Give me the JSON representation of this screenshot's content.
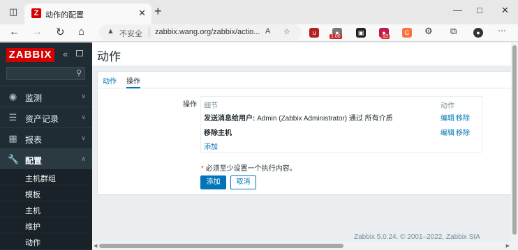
{
  "browser": {
    "tab_title": "动作的配置",
    "favicon_letter": "Z",
    "insecure_label": "不安全",
    "url": "zabbix.wang.org/zabbix/actio...",
    "ext_badge_1": "1.00",
    "ext_badge_2": "13",
    "icons": [
      "sidebar-toggle-icon",
      "close-icon",
      "plus-icon",
      "minimize-icon",
      "maximize-icon",
      "back-icon",
      "forward-icon",
      "reload-icon",
      "home-icon",
      "warning-icon",
      "read-aloud-icon",
      "favorite-icon",
      "ublock-icon",
      "extension-icon",
      "collections-icon",
      "profile-avatar",
      "more-icon"
    ]
  },
  "sidebar": {
    "logo": "ZABBIX",
    "search_placeholder": "",
    "menu": [
      {
        "label": "监测",
        "icon": "eye-icon"
      },
      {
        "label": "资产记录",
        "icon": "list-icon"
      },
      {
        "label": "报表",
        "icon": "chart-icon"
      },
      {
        "label": "配置",
        "icon": "wrench-icon"
      }
    ],
    "submenu": [
      "主机群组",
      "模板",
      "主机",
      "维护",
      "动作"
    ]
  },
  "page": {
    "title": "动作",
    "tabs": [
      "动作",
      "操作"
    ],
    "operations_label": "操作",
    "table": {
      "col_details": "细节",
      "col_action": "动作",
      "rows": [
        {
          "bold": "发送消息给用户:",
          "rest": " Admin (Zabbix Administrator) 通过 所有介质",
          "edit": "编辑",
          "remove": "移除"
        },
        {
          "bold": "移除主机",
          "rest": "",
          "edit": "编辑",
          "remove": "移除"
        }
      ],
      "add_link": "添加"
    },
    "required_star": "*",
    "required_note": " 必须至少设置一个执行内容。",
    "add_button": "添加",
    "cancel_button": "取消",
    "footer": "Zabbix 5.0.24. © 2001–2022, Zabbix SIA"
  },
  "colors": {
    "brand_red": "#d40000",
    "sidebar_bg": "#1f2c33",
    "link_blue": "#0275b8"
  }
}
